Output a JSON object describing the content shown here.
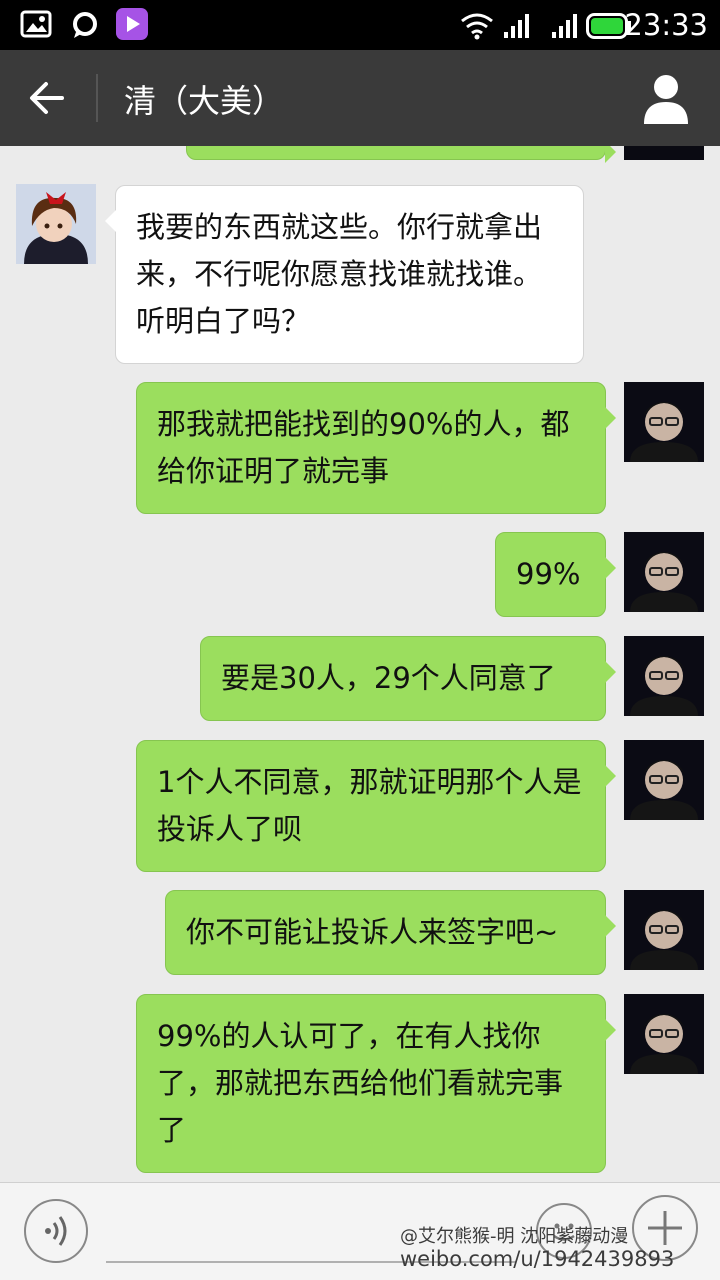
{
  "status_bar": {
    "time": "23:33",
    "icons": [
      "gallery-icon",
      "chat-notification-icon",
      "video-app-icon",
      "wifi-icon",
      "signal-1-icon",
      "signal-2-icon",
      "battery-icon"
    ],
    "battery_color": "#2fd63a"
  },
  "header": {
    "title": "清（大美）",
    "back_icon": "back-arrow-icon",
    "profile_icon": "person-icon"
  },
  "messages": [
    {
      "side": "out",
      "text": ""
    },
    {
      "side": "in",
      "text": "我要的东西就这些。你行就拿出来，不行呢你愿意找谁就找谁。听明白了吗？"
    },
    {
      "side": "out",
      "text": "那我就把能找到的90%的人，都给你证明了就完事"
    },
    {
      "side": "out",
      "text": "99%"
    },
    {
      "side": "out",
      "text": "要是30人，29个人同意了"
    },
    {
      "side": "out",
      "text": "1个人不同意，那就证明那个人是投诉人了呗"
    },
    {
      "side": "out",
      "text": "你不可能让投诉人来签字吧~"
    },
    {
      "side": "out",
      "text": "99%的人认可了，在有人找你了，那就把东西给他们看就完事了"
    }
  ],
  "input_bar": {
    "voice_icon": "voice-icon",
    "emoji_icon": "emoji-icon",
    "plus_icon": "plus-icon"
  },
  "watermark": {
    "line1": "@艾尔熊猴-明 沈阳紫藤动漫",
    "line2": "weibo.com/u/1942439893"
  },
  "colors": {
    "outgoing_bubble": "#9bde5e",
    "incoming_bubble": "#ffffff",
    "header_bg": "#3a3a3a",
    "chat_bg": "#ebebeb"
  }
}
